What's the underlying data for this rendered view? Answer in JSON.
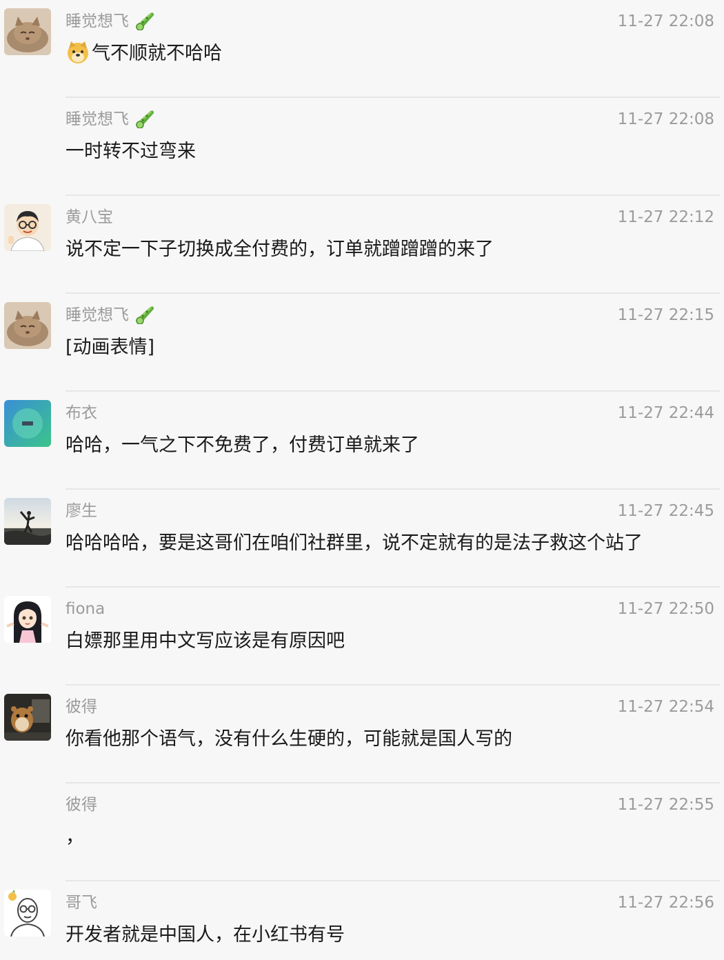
{
  "messages": [
    {
      "name": "睡觉想飞",
      "time": "11-27 22:08",
      "text": "气不顺就不哈哈",
      "emoji": "doge-icon",
      "badge": "cucumber-icon",
      "avatar": "cat"
    },
    {
      "name": "睡觉想飞",
      "time": "11-27 22:08",
      "text": "一时转不过弯来",
      "badge": "cucumber-icon",
      "avatar": "none"
    },
    {
      "name": "黄八宝",
      "time": "11-27 22:12",
      "text": "说不定一下子切换成全付费的，订单就蹭蹭蹭的来了",
      "avatar": "cartoon"
    },
    {
      "name": "睡觉想飞",
      "time": "11-27 22:15",
      "text": "[动画表情]",
      "badge": "cucumber-icon",
      "avatar": "cat"
    },
    {
      "name": "布衣",
      "time": "11-27 22:44",
      "text": "哈哈，一气之下不免费了，付费订单就来了",
      "avatar": "green"
    },
    {
      "name": "廖生",
      "time": "11-27 22:45",
      "text": "哈哈哈哈，要是这哥们在咱们社群里，说不定就有的是法子救这个站了",
      "avatar": "beach"
    },
    {
      "name": "fiona",
      "time": "11-27 22:50",
      "text": "白嫖那里用中文写应该是有原因吧",
      "avatar": "anime"
    },
    {
      "name": "彼得",
      "time": "11-27 22:54",
      "text": "你看他那个语气，没有什么生硬的，可能就是国人写的",
      "avatar": "hamster"
    },
    {
      "name": "彼得",
      "time": "11-27 22:55",
      "text": "，",
      "avatar": "none"
    },
    {
      "name": "哥飞",
      "time": "11-27 22:56",
      "text": "开发者就是中国人，在小红书有号",
      "avatar": "sketch"
    }
  ]
}
